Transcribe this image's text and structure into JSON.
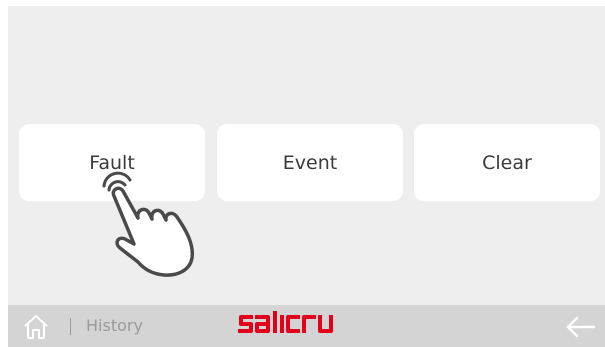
{
  "buttons": {
    "fault": "Fault",
    "event": "Event",
    "clear": "Clear"
  },
  "bottom_bar": {
    "breadcrumb": "History",
    "logo": "SALICRU",
    "home_icon": "home-icon",
    "back_icon": "arrow-left-icon"
  },
  "colors": {
    "background": "#eeeeee",
    "button": "#ffffff",
    "bottom_bar": "#d4d4d4",
    "logo": "#e3001b"
  }
}
